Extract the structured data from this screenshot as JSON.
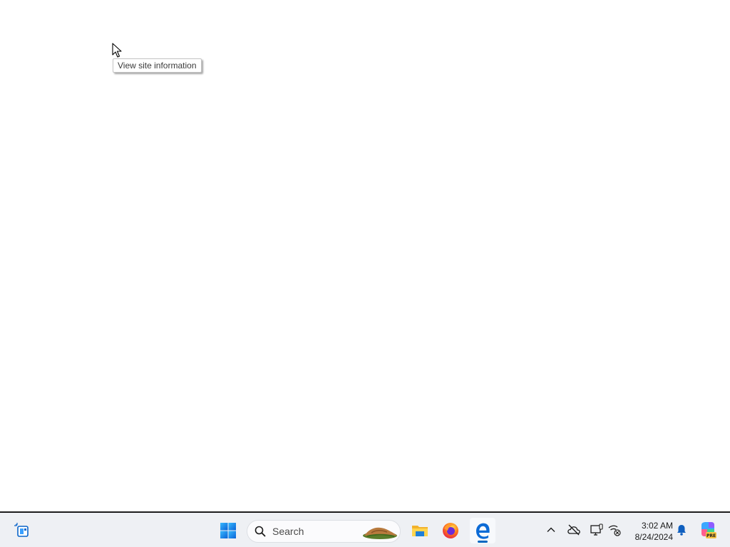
{
  "tooltip": {
    "text": "View site information"
  },
  "taskbar": {
    "widgets_icon": "widgets-icon",
    "start_icon": "windows-start-icon",
    "search": {
      "placeholder": "Search",
      "icon": "search-icon",
      "highlight_icon": "search-highlight-image"
    },
    "pinned_apps": [
      {
        "name": "File Explorer",
        "icon": "folder-icon"
      },
      {
        "name": "Firefox",
        "icon": "firefox-icon"
      },
      {
        "name": "Microsoft Edge",
        "icon": "edge-icon",
        "active": true
      }
    ],
    "tray": {
      "chevron_icon": "chevron-up-icon",
      "onedrive_icon": "onedrive-offline-icon",
      "display_icon": "display-icon",
      "network_icon": "network-disconnected-icon",
      "bell_icon": "notification-bell-icon",
      "copilot_icon": "copilot-pre-icon",
      "copilot_badge": "PRE"
    },
    "clock": {
      "time": "3:02 AM",
      "date": "8/24/2024"
    }
  },
  "colors": {
    "accent": "#0067c0",
    "taskbar_bg": "#eef0f4",
    "tooltip_border": "#c4c4c4"
  }
}
